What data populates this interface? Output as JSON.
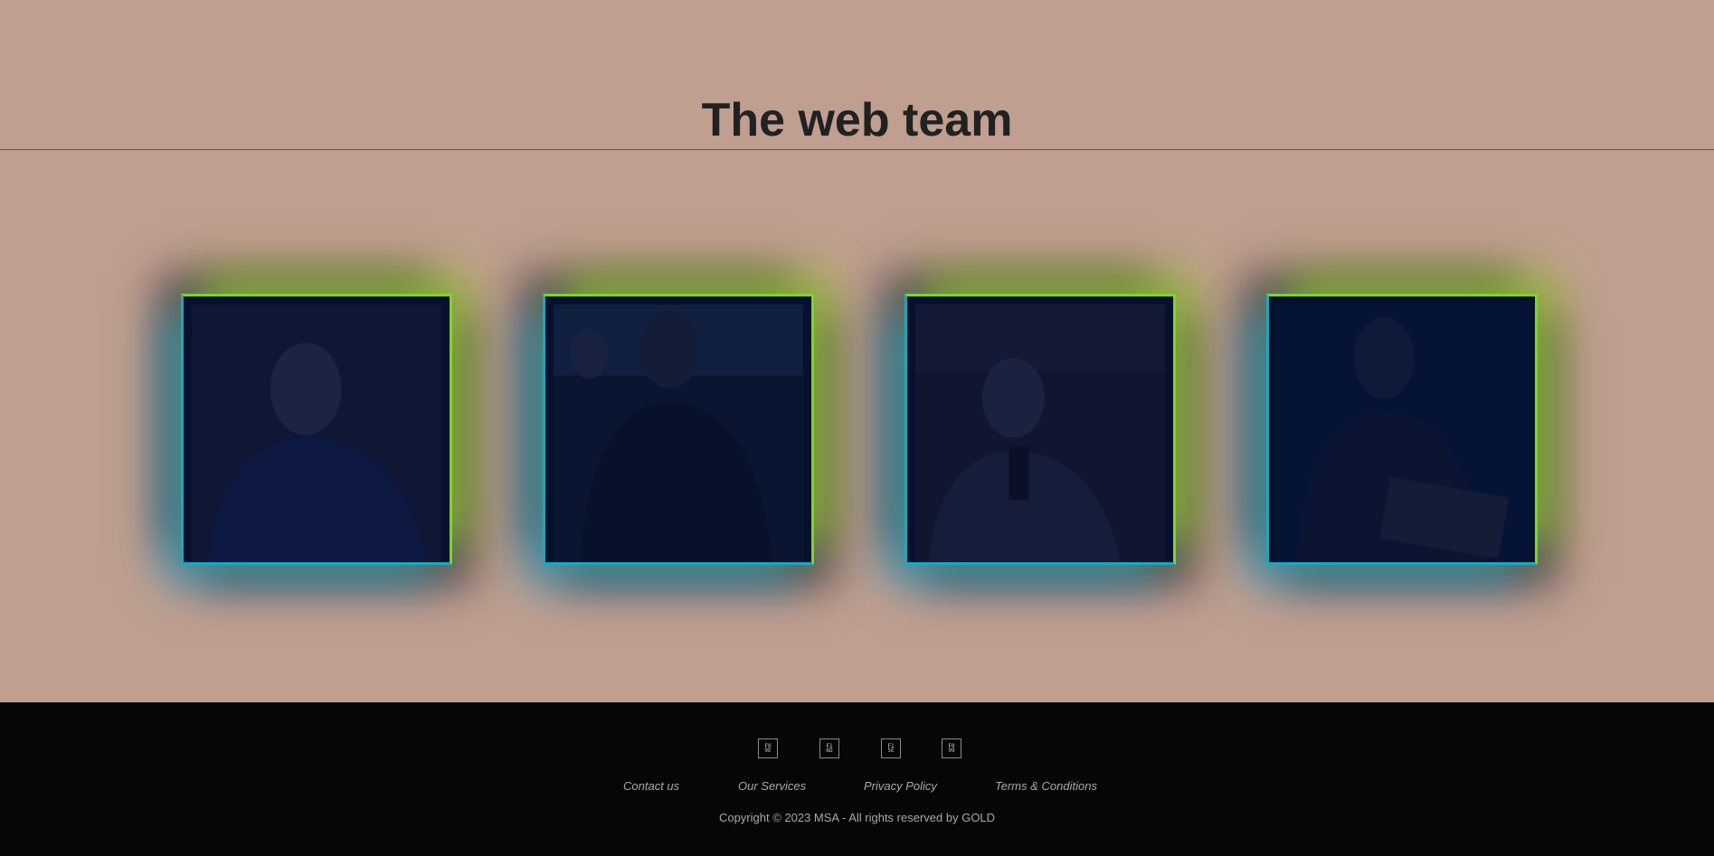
{
  "header": {
    "title": "The web team"
  },
  "team": {
    "members": [
      {
        "photo_icon": "person-portrait-icon"
      },
      {
        "photo_icon": "person-portrait-icon"
      },
      {
        "photo_icon": "person-portrait-icon"
      },
      {
        "photo_icon": "person-portrait-icon"
      }
    ]
  },
  "footer": {
    "social_icons": [
      {
        "glyph": "F0\n9E",
        "icon": "placeholder-glyph-icon"
      },
      {
        "glyph": "F1\n6D",
        "icon": "placeholder-glyph-icon"
      },
      {
        "glyph": "F1\n5E",
        "icon": "placeholder-glyph-icon"
      },
      {
        "glyph": "F0\n99",
        "icon": "placeholder-glyph-icon"
      }
    ],
    "links": [
      "Contact us",
      "Our Services",
      "Privacy Policy",
      "Terms & Conditions"
    ],
    "copyright": "Copyright © 2023 MSA - All rights reserved by GOLD"
  },
  "colors": {
    "page_background": "#c09f90",
    "title_text": "#212121",
    "footer_background": "#060606",
    "footer_text": "#a8a8a8",
    "card_border_top_right": "#7ed42a",
    "card_border_bottom_left": "#1fa6bb",
    "card_fill": "#06112e"
  }
}
